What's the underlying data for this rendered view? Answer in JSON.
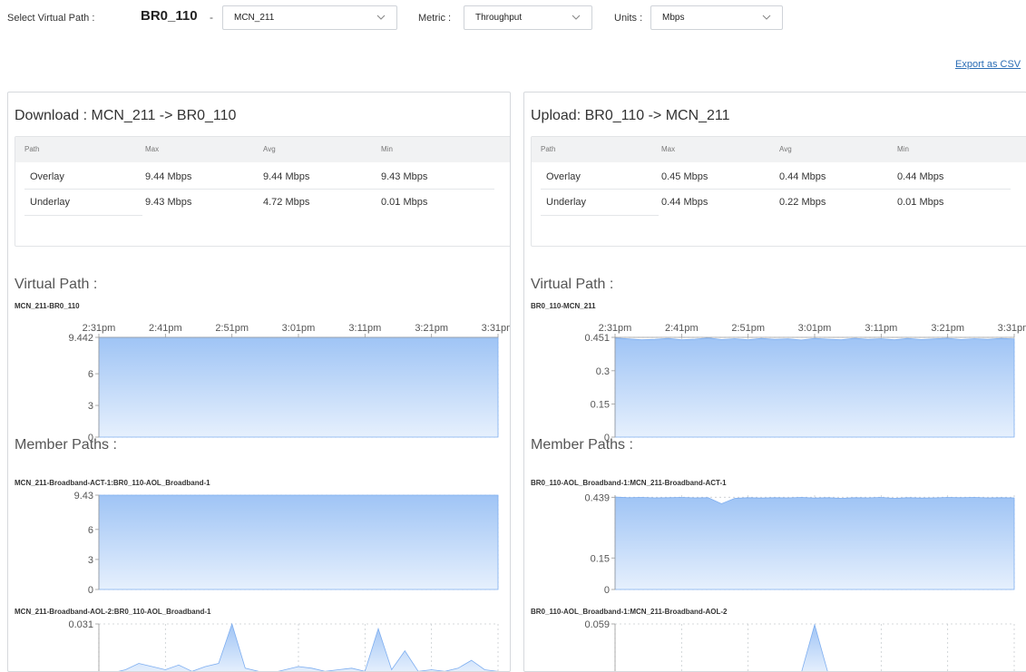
{
  "toolbar": {
    "select_label": "Select Virtual Path :",
    "site": "BR0_110",
    "site_separator": "-",
    "path_value": "MCN_211",
    "metric_label": "Metric :",
    "metric_value": "Throughput",
    "units_label": "Units :",
    "units_value": "Mbps",
    "export_label": "Export as CSV"
  },
  "colors": {
    "area_fill_top": "#9fc4f5",
    "area_fill_bottom": "#e6f0fd",
    "area_line": "#7eaef0",
    "grid": "#c8ccd0",
    "link": "#2a6db5"
  },
  "panels": [
    {
      "title": "Download : MCN_211 -> BR0_110",
      "table": {
        "headers": [
          "Path",
          "Max",
          "Avg",
          "Min"
        ],
        "rows": [
          [
            "Overlay",
            "9.44 Mbps",
            "9.44 Mbps",
            "9.43 Mbps"
          ],
          [
            "Underlay",
            "9.43 Mbps",
            "4.72 Mbps",
            "0.01 Mbps"
          ]
        ]
      },
      "virtual_title": "Virtual Path :",
      "virtual_chart_name": "MCN_211-BR0_110",
      "member_title": "Member Paths :",
      "member_chart_names": [
        "MCN_211-Broadband-ACT-1:BR0_110-AOL_Broadband-1",
        "MCN_211-Broadband-AOL-2:BR0_110-AOL_Broadband-1"
      ]
    },
    {
      "title": "Upload: BR0_110 -> MCN_211",
      "table": {
        "headers": [
          "Path",
          "Max",
          "Avg",
          "Min"
        ],
        "rows": [
          [
            "Overlay",
            "0.45 Mbps",
            "0.44 Mbps",
            "0.44 Mbps"
          ],
          [
            "Underlay",
            "0.44 Mbps",
            "0.22 Mbps",
            "0.01 Mbps"
          ]
        ]
      },
      "virtual_title": "Virtual Path :",
      "virtual_chart_name": "BR0_110-MCN_211",
      "member_title": "Member Paths :",
      "member_chart_names": [
        "BR0_110-AOL_Broadband-1:MCN_211-Broadband-ACT-1",
        "BR0_110-AOL_Broadband-1:MCN_211-Broadband-AOL-2"
      ]
    }
  ],
  "chart_data": [
    {
      "type": "area",
      "name": "MCN_211-BR0_110",
      "x_ticks": [
        "2:31pm",
        "2:41pm",
        "2:51pm",
        "3:01pm",
        "3:11pm",
        "3:21pm",
        "3:31pm"
      ],
      "y_ticks": [
        "9.442",
        "6",
        "3",
        "0"
      ],
      "ylim": [
        0,
        9.442
      ],
      "values": [
        9.44,
        9.44,
        9.44,
        9.44,
        9.44,
        9.44,
        9.44,
        9.44,
        9.44,
        9.44,
        9.44,
        9.44,
        9.44,
        9.44,
        9.44,
        9.44,
        9.44,
        9.44,
        9.44,
        9.44,
        9.44,
        9.44,
        9.44,
        9.44,
        9.44,
        9.44,
        9.44,
        9.44,
        9.44,
        9.44,
        9.44
      ],
      "grid": true
    },
    {
      "type": "area",
      "name": "MCN_211-Broadband-ACT-1:BR0_110-AOL_Broadband-1",
      "y_ticks": [
        "9.43",
        "6",
        "3",
        "0"
      ],
      "ylim": [
        0,
        9.43
      ],
      "values": [
        9.43,
        9.43,
        9.43,
        9.43,
        9.43,
        9.43,
        9.43,
        9.43,
        9.43,
        9.43,
        9.43,
        9.43,
        9.43,
        9.43,
        9.43,
        9.43,
        9.43,
        9.43,
        9.43,
        9.43,
        9.43,
        9.43,
        9.43,
        9.43,
        9.43,
        9.43,
        9.43,
        9.43,
        9.43,
        9.43,
        9.43
      ],
      "grid": true
    },
    {
      "type": "area",
      "name": "MCN_211-Broadband-AOL-2:BR0_110-AOL_Broadband-1",
      "y_ticks": [
        "0.031"
      ],
      "ylim": [
        0,
        0.031
      ],
      "values": [
        0,
        0,
        0.002,
        0.006,
        0.004,
        0.002,
        0.005,
        0.001,
        0.004,
        0.006,
        0.031,
        0.003,
        0.001,
        0,
        0.002,
        0.004,
        0.003,
        0.001,
        0.002,
        0.003,
        0.001,
        0.028,
        0.002,
        0.014,
        0.001,
        0.002,
        0.001,
        0.003,
        0.008,
        0.002,
        0.001
      ],
      "grid": true
    },
    {
      "type": "area",
      "name": "BR0_110-MCN_211",
      "x_ticks": [
        "2:31pm",
        "2:41pm",
        "2:51pm",
        "3:01pm",
        "3:11pm",
        "3:21pm",
        "3:31pm"
      ],
      "y_ticks": [
        "0.451",
        "0.3",
        "0.15",
        "0"
      ],
      "ylim": [
        0,
        0.451
      ],
      "values": [
        0.448,
        0.444,
        0.44,
        0.442,
        0.446,
        0.44,
        0.443,
        0.448,
        0.441,
        0.445,
        0.44,
        0.446,
        0.442,
        0.444,
        0.439,
        0.446,
        0.443,
        0.44,
        0.447,
        0.442,
        0.445,
        0.44,
        0.446,
        0.441,
        0.444,
        0.447,
        0.441,
        0.445,
        0.442,
        0.446,
        0.444
      ],
      "grid": true
    },
    {
      "type": "area",
      "name": "BR0_110-AOL_Broadband-1:MCN_211-Broadband-ACT-1",
      "y_ticks": [
        "0.439",
        "0.15",
        "0"
      ],
      "ylim": [
        0,
        0.449
      ],
      "values": [
        0.44,
        0.437,
        0.438,
        0.436,
        0.437,
        0.438,
        0.436,
        0.437,
        0.408,
        0.434,
        0.437,
        0.435,
        0.437,
        0.436,
        0.438,
        0.435,
        0.437,
        0.434,
        0.437,
        0.436,
        0.438,
        0.434,
        0.437,
        0.435,
        0.436,
        0.438,
        0.437,
        0.438,
        0.436,
        0.437,
        0.436
      ],
      "grid": true
    },
    {
      "type": "area",
      "name": "BR0_110-AOL_Broadband-1:MCN_211-Broadband-AOL-2",
      "y_ticks": [
        "0.059"
      ],
      "ylim": [
        0,
        0.059
      ],
      "values": [
        0,
        0,
        0,
        0,
        0,
        0,
        0,
        0,
        0,
        0,
        0,
        0,
        0,
        0,
        0,
        0.058,
        0,
        0,
        0,
        0,
        0,
        0,
        0,
        0,
        0,
        0,
        0,
        0,
        0,
        0,
        0
      ],
      "grid": true
    }
  ]
}
